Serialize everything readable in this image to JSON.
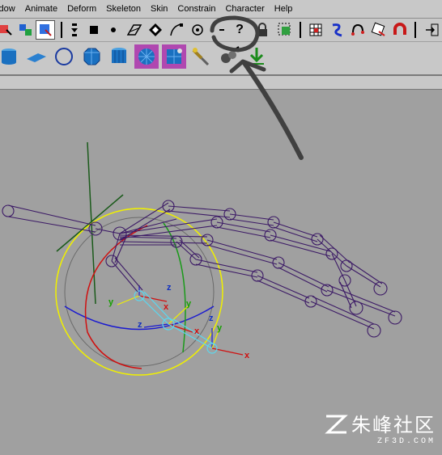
{
  "menus": [
    "indow",
    "Animate",
    "Deform",
    "Skeleton",
    "Skin",
    "Constrain",
    "Character",
    "Help"
  ],
  "toolbar": {
    "help_label": "?"
  },
  "icons": {
    "toolbar": [
      "select-by-hierarchy-icon",
      "select-by-object-icon",
      "select-by-component-icon",
      "snap-to-grid-icon",
      "snap-to-curve-icon",
      "snap-to-point-icon",
      "snap-to-view-plane-icon",
      "make-live-icon",
      "query-icon",
      "lock-icon",
      "highlight-select-icon",
      "render-icon",
      "ipr-render-icon",
      "render-settings-icon",
      "hypershade-icon",
      "input-output-icon"
    ],
    "shelf": [
      "cylinder-icon",
      "plane-icon",
      "sphere-icon",
      "poly-cylinder-icon",
      "poly-cube-icon",
      "poly-sphere-icon",
      "poly-subdiv-icon",
      "sculpt-tool-icon",
      "paint-weights-icon",
      "move-down-icon"
    ]
  },
  "viewport": {
    "axis_labels": [
      {
        "text": "y",
        "color": "#16a000"
      },
      {
        "text": "z",
        "color": "#1030c0"
      },
      {
        "text": "x",
        "color": "#d01010"
      },
      {
        "text": "z",
        "color": "#1030c0"
      },
      {
        "text": "y",
        "color": "#16a000"
      },
      {
        "text": "x",
        "color": "#d01010"
      },
      {
        "text": "z",
        "color": "#1030c0"
      },
      {
        "text": "y",
        "color": "#16a000"
      },
      {
        "text": "x",
        "color": "#d01010"
      }
    ]
  },
  "watermark": {
    "chinese": "朱峰社区",
    "url": "ZF3D.COM"
  },
  "colors": {
    "ui_gray": "#c8c8c8",
    "viewport": "#a0a0a0",
    "joint": "#3c1a66",
    "annotation": "#404040"
  }
}
